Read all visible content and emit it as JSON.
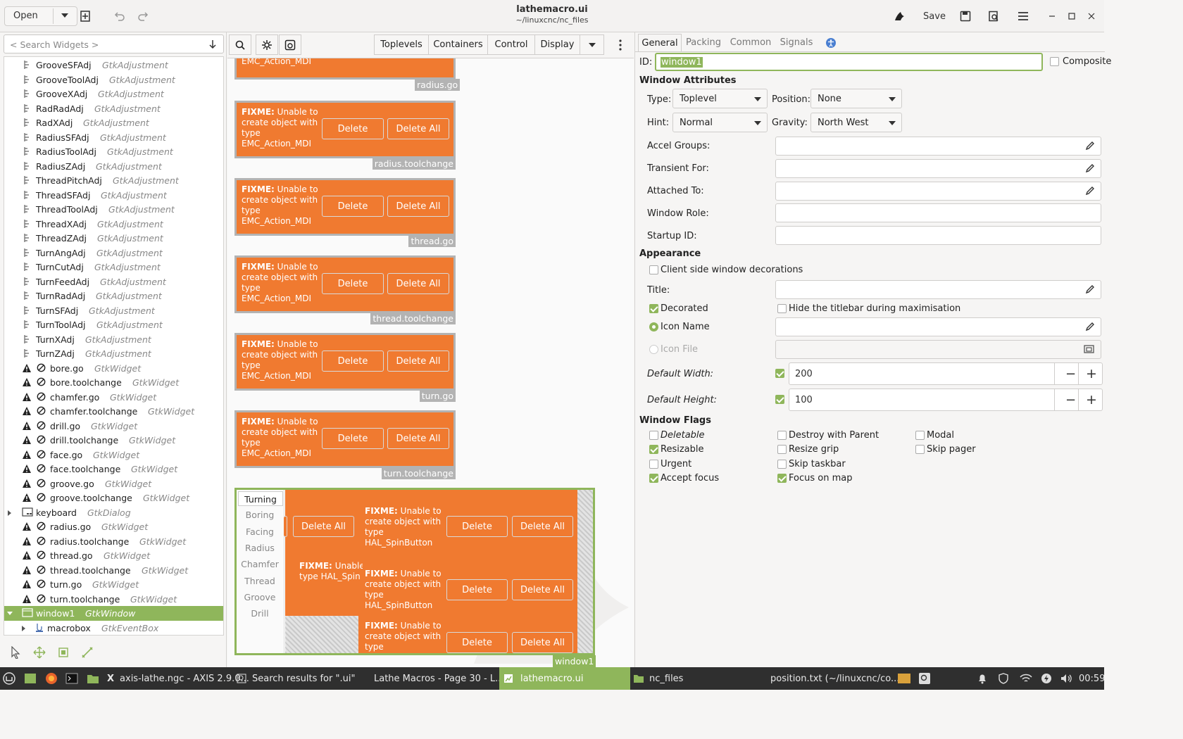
{
  "header": {
    "open_label": "Open",
    "title": "lathemacro.ui",
    "subtitle": "~/linuxcnc/nc_files",
    "save_label": "Save"
  },
  "search": {
    "placeholder": "< Search Widgets >"
  },
  "tree": [
    {
      "name": "GrooveSFAdj",
      "type": "GtkAdjustment",
      "kind": "adj"
    },
    {
      "name": "GrooveToolAdj",
      "type": "GtkAdjustment",
      "kind": "adj"
    },
    {
      "name": "GrooveXAdj",
      "type": "GtkAdjustment",
      "kind": "adj"
    },
    {
      "name": "RadRadAdj",
      "type": "GtkAdjustment",
      "kind": "adj"
    },
    {
      "name": "RadXAdj",
      "type": "GtkAdjustment",
      "kind": "adj"
    },
    {
      "name": "RadiusSFAdj",
      "type": "GtkAdjustment",
      "kind": "adj"
    },
    {
      "name": "RadiusToolAdj",
      "type": "GtkAdjustment",
      "kind": "adj"
    },
    {
      "name": "RadiusZAdj",
      "type": "GtkAdjustment",
      "kind": "adj"
    },
    {
      "name": "ThreadPitchAdj",
      "type": "GtkAdjustment",
      "kind": "adj"
    },
    {
      "name": "ThreadSFAdj",
      "type": "GtkAdjustment",
      "kind": "adj"
    },
    {
      "name": "ThreadToolAdj",
      "type": "GtkAdjustment",
      "kind": "adj"
    },
    {
      "name": "ThreadXAdj",
      "type": "GtkAdjustment",
      "kind": "adj"
    },
    {
      "name": "ThreadZAdj",
      "type": "GtkAdjustment",
      "kind": "adj"
    },
    {
      "name": "TurnAngAdj",
      "type": "GtkAdjustment",
      "kind": "adj"
    },
    {
      "name": "TurnCutAdj",
      "type": "GtkAdjustment",
      "kind": "adj"
    },
    {
      "name": "TurnFeedAdj",
      "type": "GtkAdjustment",
      "kind": "adj"
    },
    {
      "name": "TurnRadAdj",
      "type": "GtkAdjustment",
      "kind": "adj"
    },
    {
      "name": "TurnSFAdj",
      "type": "GtkAdjustment",
      "kind": "adj"
    },
    {
      "name": "TurnToolAdj",
      "type": "GtkAdjustment",
      "kind": "adj"
    },
    {
      "name": "TurnXAdj",
      "type": "GtkAdjustment",
      "kind": "adj"
    },
    {
      "name": "TurnZAdj",
      "type": "GtkAdjustment",
      "kind": "adj"
    },
    {
      "name": "bore.go",
      "type": "GtkWidget",
      "kind": "warn"
    },
    {
      "name": "bore.toolchange",
      "type": "GtkWidget",
      "kind": "warn"
    },
    {
      "name": "chamfer.go",
      "type": "GtkWidget",
      "kind": "warn"
    },
    {
      "name": "chamfer.toolchange",
      "type": "GtkWidget",
      "kind": "warn"
    },
    {
      "name": "drill.go",
      "type": "GtkWidget",
      "kind": "warn"
    },
    {
      "name": "drill.toolchange",
      "type": "GtkWidget",
      "kind": "warn"
    },
    {
      "name": "face.go",
      "type": "GtkWidget",
      "kind": "warn"
    },
    {
      "name": "face.toolchange",
      "type": "GtkWidget",
      "kind": "warn"
    },
    {
      "name": "groove.go",
      "type": "GtkWidget",
      "kind": "warn"
    },
    {
      "name": "groove.toolchange",
      "type": "GtkWidget",
      "kind": "warn"
    },
    {
      "name": "keyboard",
      "type": "GtkDialog",
      "kind": "dialog"
    },
    {
      "name": "radius.go",
      "type": "GtkWidget",
      "kind": "warn"
    },
    {
      "name": "radius.toolchange",
      "type": "GtkWidget",
      "kind": "warn"
    },
    {
      "name": "thread.go",
      "type": "GtkWidget",
      "kind": "warn"
    },
    {
      "name": "thread.toolchange",
      "type": "GtkWidget",
      "kind": "warn"
    },
    {
      "name": "turn.go",
      "type": "GtkWidget",
      "kind": "warn"
    },
    {
      "name": "turn.toolchange",
      "type": "GtkWidget",
      "kind": "warn"
    },
    {
      "name": "window1",
      "type": "GtkWindow",
      "kind": "window"
    },
    {
      "name": "macrobox",
      "type": "GtkEventBox",
      "kind": "eventbox"
    }
  ],
  "palette": {
    "toplevels": "Toplevels",
    "containers": "Containers",
    "control": "Control",
    "display": "Display"
  },
  "canvas": {
    "fixme_bold": "FIXME:",
    "fixme_rest": " Unable to create object with type EMC_Action_MDI",
    "delete": "Delete",
    "delete_all": "Delete All",
    "top_label": "radius.go",
    "cards": [
      {
        "label": "radius.toolchange"
      },
      {
        "label": "thread.go"
      },
      {
        "label": "thread.toolchange"
      },
      {
        "label": "turn.go"
      },
      {
        "label": "turn.toolchange"
      }
    ],
    "window_label": "window1",
    "tabs": [
      "Turning",
      "Boring",
      "Facing",
      "Radius",
      "Chamfer",
      "Thread",
      "Groove",
      "Drill"
    ],
    "spin_rest": " Unable to create object with type HAL_SpinButton",
    "spin_partial_bold": "FIXME:",
    "spin_partial_rest": " Unable to create object with type HAL_Spin",
    "spin_partial_line1": "Unable",
    "spin_partial_line2": "type HAL_Spin",
    "last_partial": " Unable to create object with type"
  },
  "props": {
    "tabs": [
      "General",
      "Packing",
      "Common",
      "Signals"
    ],
    "id_label": "ID:",
    "id_value": "window1",
    "composite": "Composite",
    "window_attributes": "Window Attributes",
    "type_label": "Type:",
    "type_value": "Toplevel",
    "position_label": "Position:",
    "position_value": "None",
    "hint_label": "Hint:",
    "hint_value": "Normal",
    "gravity_label": "Gravity:",
    "gravity_value": "North West",
    "accel_groups": "Accel Groups:",
    "transient_for": "Transient For:",
    "attached_to": "Attached To:",
    "window_role": "Window Role:",
    "startup_id": "Startup ID:",
    "appearance": "Appearance",
    "client_side": "Client side window decorations",
    "title_label": "Title:",
    "decorated": "Decorated",
    "hide_titlebar": "Hide the titlebar during maximisation",
    "icon_name": "Icon Name",
    "icon_file": "Icon File",
    "default_width": "Default Width:",
    "default_width_value": "200",
    "default_height": "Default Height:",
    "default_height_value": "100",
    "window_flags": "Window Flags",
    "flags": {
      "deletable": "Deletable",
      "destroy_with_parent": "Destroy with Parent",
      "modal": "Modal",
      "resizable": "Resizable",
      "resize_grip": "Resize grip",
      "skip_pager": "Skip pager",
      "urgent": "Urgent",
      "skip_taskbar": "Skip taskbar",
      "accept_focus": "Accept focus",
      "focus_on_map": "Focus on map"
    }
  },
  "taskbar": {
    "items": [
      "axis-lathe.ngc - AXIS 2.9.0...",
      "Search results for \".ui\"",
      "Lathe Macros - Page 30 - L...",
      "lathemacro.ui",
      "nc_files",
      "position.txt (~/linuxcnc/co..."
    ],
    "clock": "00:59"
  },
  "colors": {
    "accent": "#8fb65b",
    "orange": "#f07a30",
    "taskbar": "#2f2f2f"
  }
}
